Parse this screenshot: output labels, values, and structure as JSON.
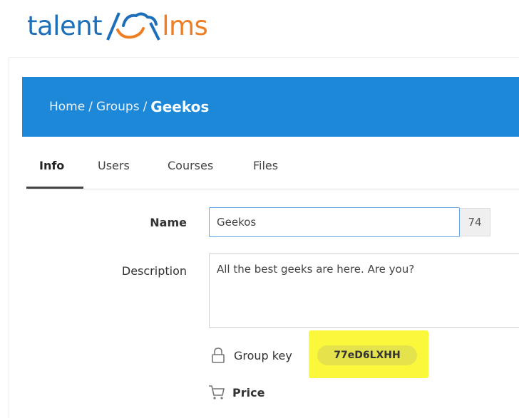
{
  "logo": {
    "part1": "talent",
    "part2": "lms",
    "cloud_icon": "cloud-icon"
  },
  "breadcrumb": {
    "items": [
      "Home",
      "Groups"
    ],
    "separator": "/",
    "current": "Geekos"
  },
  "tabs": [
    {
      "label": "Info",
      "active": true
    },
    {
      "label": "Users",
      "active": false
    },
    {
      "label": "Courses",
      "active": false
    },
    {
      "label": "Files",
      "active": false
    }
  ],
  "form": {
    "name_label": "Name",
    "name_value": "Geekos",
    "name_counter": "74",
    "description_label": "Description",
    "description_value": "All the best geeks are here. Are you?",
    "group_key_icon": "lock-icon",
    "group_key_label": "Group key",
    "group_key_value": "77eD6LXHH",
    "price_icon": "cart-icon",
    "price_label": "Price"
  },
  "colors": {
    "brand_blue": "#1d87d8",
    "logo_blue": "#1c6fb8",
    "logo_orange": "#ef7d22",
    "highlight": "#fbf73a"
  }
}
